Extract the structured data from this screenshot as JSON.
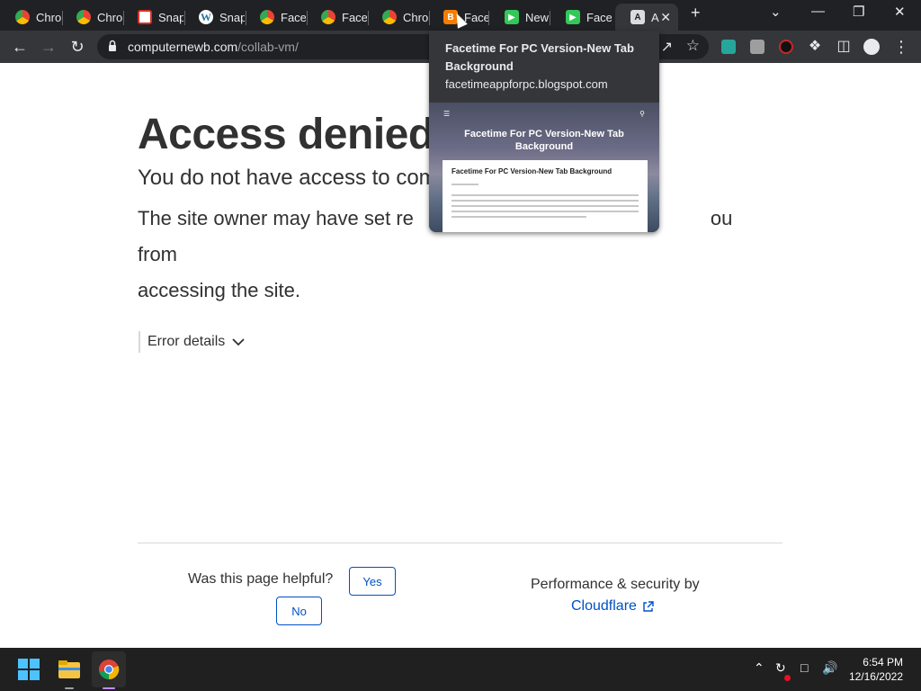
{
  "browser": {
    "tabs": [
      {
        "title": "Chro",
        "icon": "chrome-icon"
      },
      {
        "title": "Chro",
        "icon": "chrome-icon"
      },
      {
        "title": "Snap",
        "icon": "snap-icon"
      },
      {
        "title": "Snap",
        "icon": "wordpress-icon"
      },
      {
        "title": "Facet",
        "icon": "chrome-icon"
      },
      {
        "title": "Facet",
        "icon": "chrome-icon"
      },
      {
        "title": "Chro",
        "icon": "chrome-icon"
      },
      {
        "title": "Facet",
        "icon": "blogger-icon"
      },
      {
        "title": "New",
        "icon": "facetime-icon"
      },
      {
        "title": "Facet",
        "icon": "facetime-icon"
      },
      {
        "title": "A",
        "icon": "access-icon"
      }
    ],
    "new_tab_label": "+",
    "url_host": "computernewb.com",
    "url_path": "/collab-vm/"
  },
  "hover_card": {
    "title": "Facetime For PC Version-New Tab Background",
    "domain": "facetimeappforpc.blogspot.com",
    "preview_heading": "Facetime For PC Version-New Tab Background",
    "preview_article_title": "Facetime For PC Version-New Tab Background"
  },
  "page": {
    "heading": "Access denied",
    "subheading": "You do not have access to com",
    "body_line1_start": "The site owner may have set re",
    "body_line1_end": "ou from",
    "body_line2": "accessing the site.",
    "error_details": "Error details",
    "helpful_question": "Was this page helpful?",
    "yes_label": "Yes",
    "no_label": "No",
    "perf_label": "Performance & security by",
    "cloudflare_label": "Cloudflare"
  },
  "taskbar": {
    "time": "6:54 PM",
    "date": "12/16/2022"
  },
  "colors": {
    "accent": "#0051c3",
    "tab_bar": "#202124",
    "toolbar": "#35363a"
  }
}
